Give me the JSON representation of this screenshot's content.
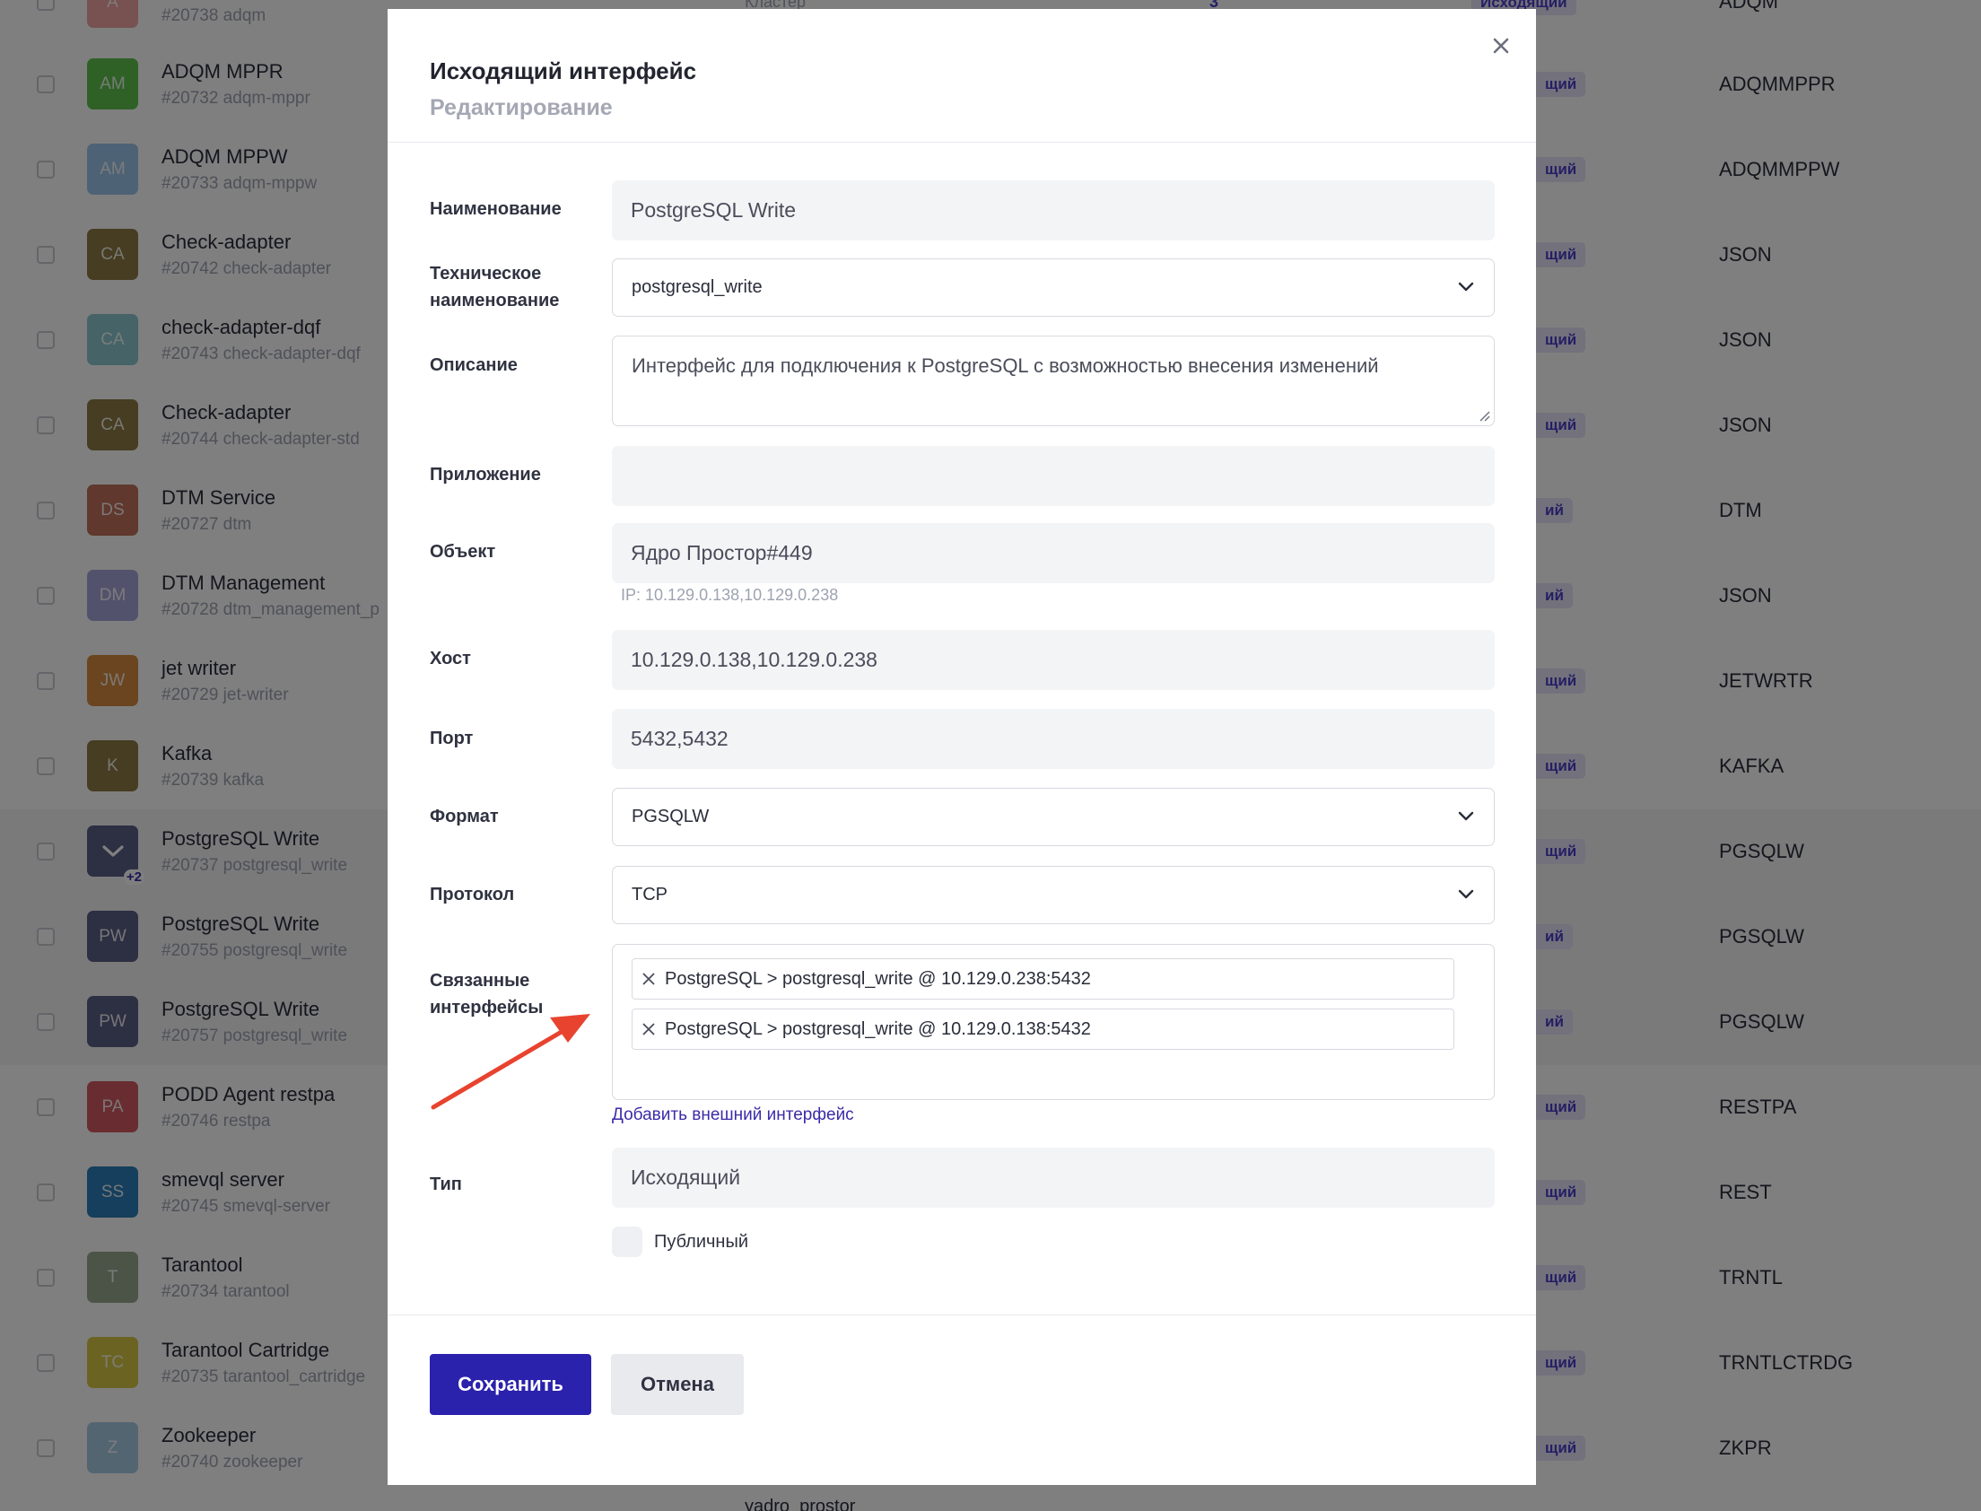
{
  "colors": {
    "accent": "#2a21ac",
    "badge_text": "#4b3fc9",
    "annotation_arrow": "#e8432f"
  },
  "background_list": {
    "top_partial": {
      "code": "#20738 adqm",
      "avatar": "A",
      "column_text": "Кластер",
      "column_number": "3",
      "badge": "Исходящий",
      "format": "ADQM"
    },
    "rows": [
      {
        "avatar": "AM",
        "avatar_color": "#5ec24e",
        "name": "ADQM MPPR",
        "code": "#20732 adqm-mppr",
        "badge": "щий",
        "format": "ADQMMPPR"
      },
      {
        "avatar": "AM",
        "avatar_color": "#9cc4ea",
        "name": "ADQM MPPW",
        "code": "#20733 adqm-mppw",
        "badge": "щий",
        "format": "ADQMMPPW"
      },
      {
        "avatar": "CA",
        "avatar_color": "#8d7a45",
        "name": "Check-adapter",
        "code": "#20742 check-adapter",
        "badge": "щий",
        "format": "JSON"
      },
      {
        "avatar": "CA",
        "avatar_color": "#8cc6cf",
        "name": "check-adapter-dqf",
        "code": "#20743 check-adapter-dqf",
        "badge": "щий",
        "format": "JSON"
      },
      {
        "avatar": "CA",
        "avatar_color": "#8d7a45",
        "name": "Check-adapter",
        "code": "#20744 check-adapter-std",
        "badge": "щий",
        "format": "JSON"
      },
      {
        "avatar": "DS",
        "avatar_color": "#c0705a",
        "name": "DTM Service",
        "code": "#20727 dtm",
        "badge": "ий",
        "format": "DTM"
      },
      {
        "avatar": "DM",
        "avatar_color": "#a7a4d8",
        "name": "DTM Management",
        "code": "#20728 dtm_management_p",
        "badge": "ий",
        "format": "JSON"
      },
      {
        "avatar": "JW",
        "avatar_color": "#d58a3e",
        "name": "jet writer",
        "code": "#20729 jet-writer",
        "badge": "щий",
        "format": "JETWRTR"
      },
      {
        "avatar": "K",
        "avatar_color": "#8d7a45",
        "name": "Kafka",
        "code": "#20739 kafka",
        "badge": "щий",
        "format": "KAFKA"
      },
      {
        "avatar": "",
        "avatar_color": "#5a5f85",
        "avatar_extra": "+2",
        "name": "PostgreSQL Write",
        "code": "#20737 postgresql_write",
        "badge": "щий",
        "format": "PGSQLW",
        "highlight": true
      },
      {
        "avatar": "PW",
        "avatar_color": "#5a5f85",
        "name": "PostgreSQL Write",
        "code": "#20755 postgresql_write",
        "badge": "ий",
        "format": "PGSQLW",
        "highlight": true
      },
      {
        "avatar": "PW",
        "avatar_color": "#5a5f85",
        "name": "PostgreSQL Write",
        "code": "#20757 postgresql_write",
        "badge": "ий",
        "format": "PGSQLW",
        "highlight": true
      },
      {
        "avatar": "PA",
        "avatar_color": "#d25b63",
        "name": "PODD Agent restpa",
        "code": "#20746 restpa",
        "badge": "щий",
        "format": "RESTPA"
      },
      {
        "avatar": "SS",
        "avatar_color": "#2b7fb8",
        "name": "smevql server",
        "code": "#20745 smevql-server",
        "badge": "щий",
        "format": "REST"
      },
      {
        "avatar": "T",
        "avatar_color": "#98a890",
        "name": "Tarantool",
        "code": "#20734 tarantool",
        "badge": "щий",
        "format": "TRNTL"
      },
      {
        "avatar": "TC",
        "avatar_color": "#d6c744",
        "name": "Tarantool Cartridge",
        "code": "#20735 tarantool_cartridge",
        "badge": "щий",
        "format": "TRNTLCTRDG"
      },
      {
        "avatar": "Z",
        "avatar_color": "#a9cbe4",
        "name": "Zookeeper",
        "code": "#20740 zookeeper",
        "badge": "щий",
        "format": "ZKPR"
      }
    ],
    "bottom_partial": {
      "column_text": "yadro_prostor"
    }
  },
  "modal": {
    "title": "Исходящий интерфейс",
    "subtitle": "Редактирование",
    "close_icon": "close-icon",
    "labels": {
      "name": "Наименование",
      "tech_name_1": "Техническое",
      "tech_name_2": "наименование",
      "description": "Описание",
      "application": "Приложение",
      "object": "Объект",
      "host": "Хост",
      "port": "Порт",
      "format": "Формат",
      "protocol": "Протокол",
      "linked_1": "Связанные",
      "linked_2": "интерфейсы",
      "type": "Тип"
    },
    "values": {
      "name": "PostgreSQL Write",
      "tech_name": "postgresql_write",
      "description": "Интерфейс для подключения к PostgreSQL с возможностью внесения изменений",
      "application": "",
      "object": "Ядро Простор#449",
      "object_hint": "IP: 10.129.0.138,10.129.0.238",
      "host": "10.129.0.138,10.129.0.238",
      "port": "5432,5432",
      "format": "PGSQLW",
      "protocol": "TCP",
      "type": "Исходящий"
    },
    "linked_interfaces": [
      "PostgreSQL > postgresql_write @ 10.129.0.238:5432",
      "PostgreSQL > postgresql_write @ 10.129.0.138:5432"
    ],
    "add_external_link": "Добавить внешний интерфейс",
    "public_checkbox": {
      "label": "Публичный",
      "checked": false
    },
    "buttons": {
      "save": "Сохранить",
      "cancel": "Отмена"
    }
  }
}
